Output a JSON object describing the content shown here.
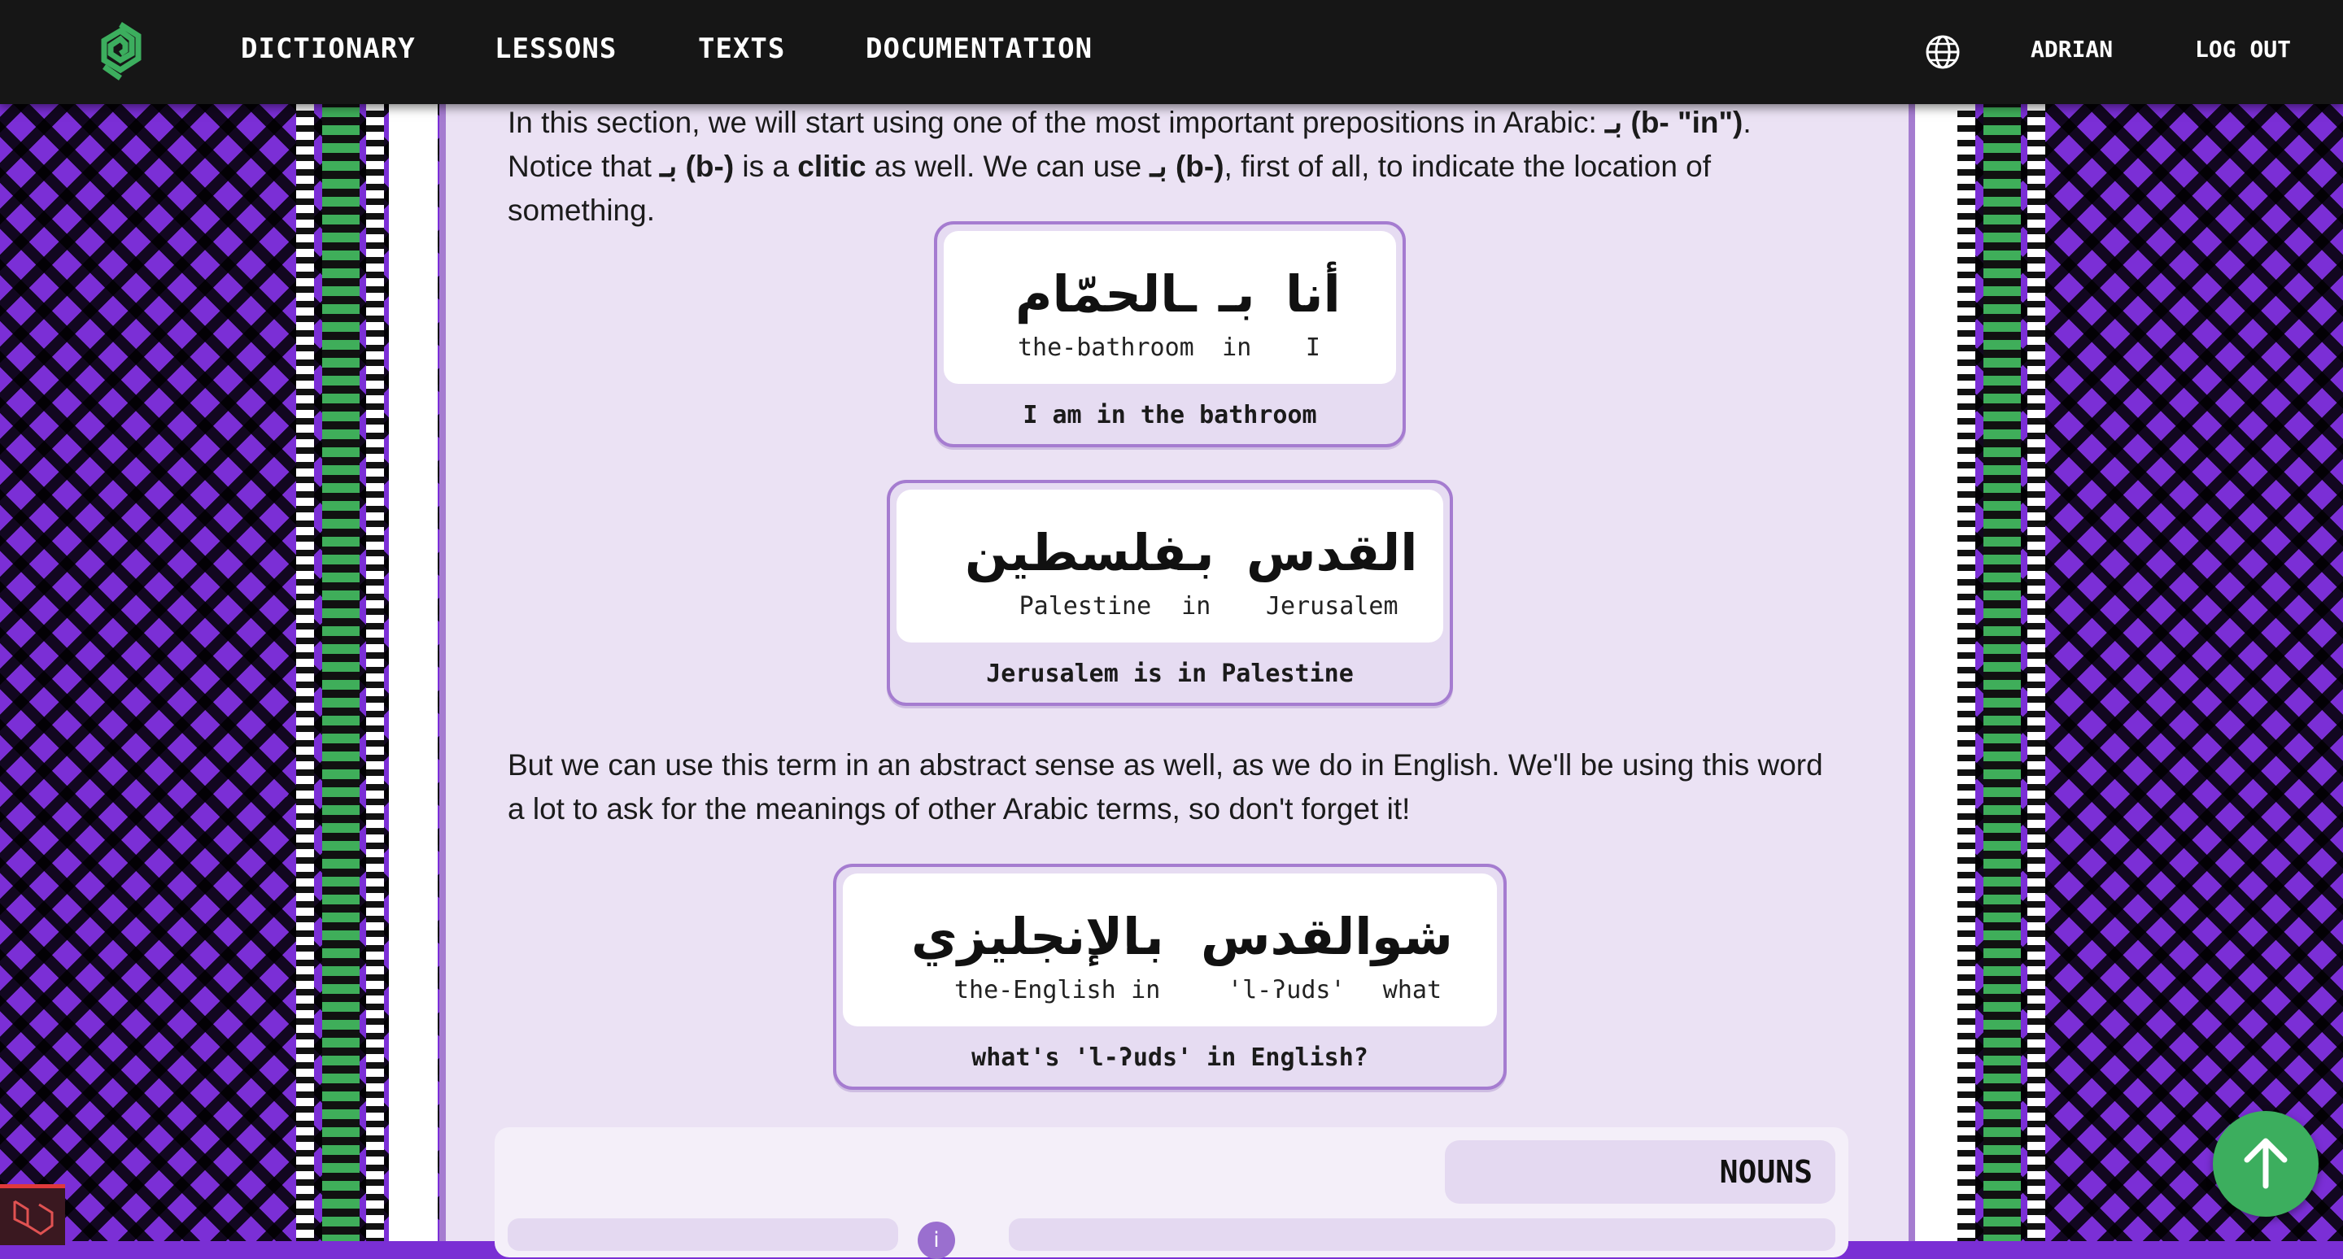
{
  "nav": {
    "items": [
      "DICTIONARY",
      "LESSONS",
      "TEXTS",
      "DOCUMENTATION"
    ],
    "user": "ADRIAN",
    "logout": "LOG OUT",
    "language_icon": "globe-icon",
    "logo_icon": "spiral-logo-icon"
  },
  "content": {
    "para1": {
      "t1": "In this section, we will start using one of the most important prepositions in Arabic: ",
      "b1": "بـ (b- \"in\")",
      "t2": ". Notice that ",
      "b2": "بـ (b-)",
      "t3": " is a ",
      "b3": "clitic",
      "t4": " as well. We can use ",
      "b4": "بـ (b-)",
      "t5": ", first of all, to indicate the location of something."
    },
    "para2": "But we can use this term in an abstract sense as well, as we do in English. We'll be using this word a lot to ask for the meanings of other Arabic terms, so don't forget it!",
    "examples": [
      {
        "words": [
          {
            "ar": "ـالحمّام",
            "gloss": "the-bathroom"
          },
          {
            "ar": "بـ",
            "gloss": "in"
          },
          {
            "ar": "أنا",
            "gloss": "I"
          }
        ],
        "translation": "I am in the bathroom"
      },
      {
        "words": [
          {
            "ar": "ـفلسطين",
            "gloss": "Palestine"
          },
          {
            "ar": "بـ",
            "gloss": "in"
          },
          {
            "ar": "القدس",
            "gloss": "Jerusalem"
          }
        ],
        "translation": "Jerusalem is in Palestine"
      },
      {
        "words": [
          {
            "ar": "ـالإنجليزي",
            "gloss": "the-English"
          },
          {
            "ar": "بـ",
            "gloss": "in"
          },
          {
            "ar": "القدس",
            "gloss": "'l-ʔuds'"
          },
          {
            "ar": "شو",
            "gloss": "what"
          }
        ],
        "translation": "what's 'l-ʔuds' in English?"
      }
    ],
    "nouns_title": "NOUNS",
    "info_icon": "info-icon"
  },
  "scroll_top_icon": "arrow-up-icon",
  "colors": {
    "purple": "#7b2fd6",
    "panel": "#ebe2f4",
    "border": "#a57cd0",
    "green": "#3cae5e",
    "nav": "#161616"
  }
}
